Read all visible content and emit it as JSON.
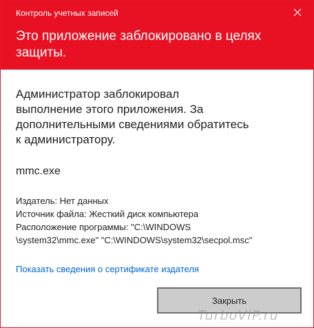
{
  "window": {
    "title": "Контроль учетных записей",
    "close_icon": "close-icon"
  },
  "header": {
    "headline": "Это приложение заблокировано в целях защиты.",
    "background_color": "#e81123"
  },
  "message": {
    "lines": [
      "Администратор заблокировал",
      "выполнение этого приложения. За",
      "дополнительными сведениями обратитесь",
      "к администратору."
    ]
  },
  "program": {
    "name": "mmc.exe"
  },
  "details": {
    "publisher": "Издатель: Нет данных",
    "source": "Источник файла: Жесткий диск компьютера",
    "location_line1": "Расположение программы: \"C:\\WINDOWS",
    "location_line2": "\\system32\\mmc.exe\" \"C:\\WINDOWS\\system32\\secpol.msc\""
  },
  "links": {
    "certificate": "Показать сведения о сертификате издателя"
  },
  "buttons": {
    "close_label": "Закрыть"
  },
  "watermark": {
    "text": "TurboVIP.ru"
  }
}
